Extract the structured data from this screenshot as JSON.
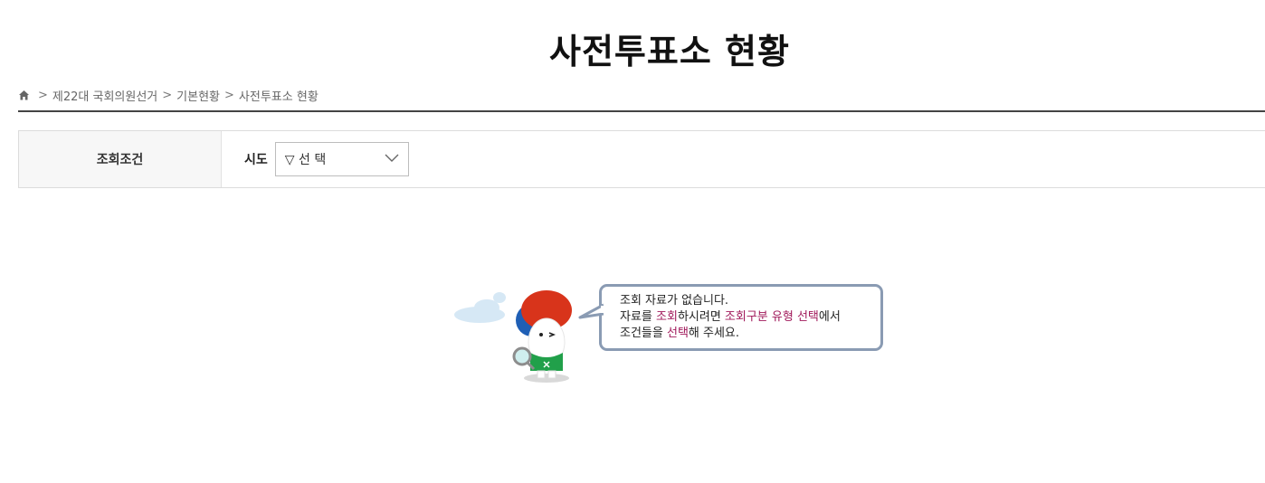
{
  "header": {
    "title": "사전투표소 현황"
  },
  "breadcrumb": {
    "home_icon": "home-icon",
    "separator": ">",
    "items": [
      "제22대 국회의원선거",
      "기본현황",
      "사전투표소 현황"
    ]
  },
  "search": {
    "condition_label": "조회조건",
    "field_label": "시도",
    "select_value": "▽ 선 택",
    "chevron_icon": "chevron-down-icon"
  },
  "empty_state": {
    "line1": "조회 자료가 없습니다.",
    "line2_parts": [
      "자료를 ",
      "조회",
      "하시려면 ",
      "조회구분 유형 선택",
      "에서"
    ],
    "line3_parts": [
      "조건들을 ",
      "선택",
      "해 주세요."
    ],
    "highlight_color": "#a0185a",
    "mascot_icon": "mascot-magnifier-icon"
  },
  "colors": {
    "rule": "#444444",
    "bubble_border": "#8a9bb3"
  }
}
